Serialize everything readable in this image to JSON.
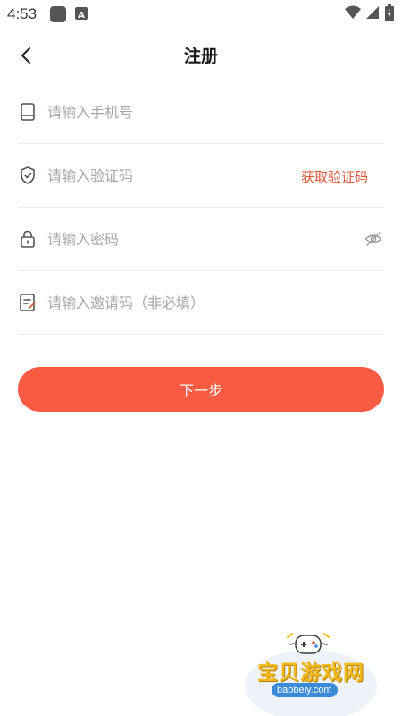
{
  "status_bar": {
    "time": "4:53"
  },
  "header": {
    "title": "注册",
    "back_icon": "chevron-left-icon"
  },
  "form": {
    "phone": {
      "placeholder": "请输入手机号",
      "icon": "phone-icon"
    },
    "code": {
      "placeholder": "请输入验证码",
      "icon": "shield-check-icon",
      "get_code_label": "获取验证码"
    },
    "password": {
      "placeholder": "请输入密码",
      "icon": "lock-icon",
      "visibility_icon": "eye-off-icon"
    },
    "invite": {
      "placeholder": "请输入邀请码（非必填）",
      "icon": "note-edit-icon"
    }
  },
  "actions": {
    "next_label": "下一步"
  },
  "watermark": {
    "title": "宝贝游戏网",
    "url": "baobeiy.com"
  },
  "colors": {
    "accent": "#f95a42",
    "link": "#e0573d",
    "placeholder": "#a6a6a6",
    "divider": "#eeeeee"
  }
}
